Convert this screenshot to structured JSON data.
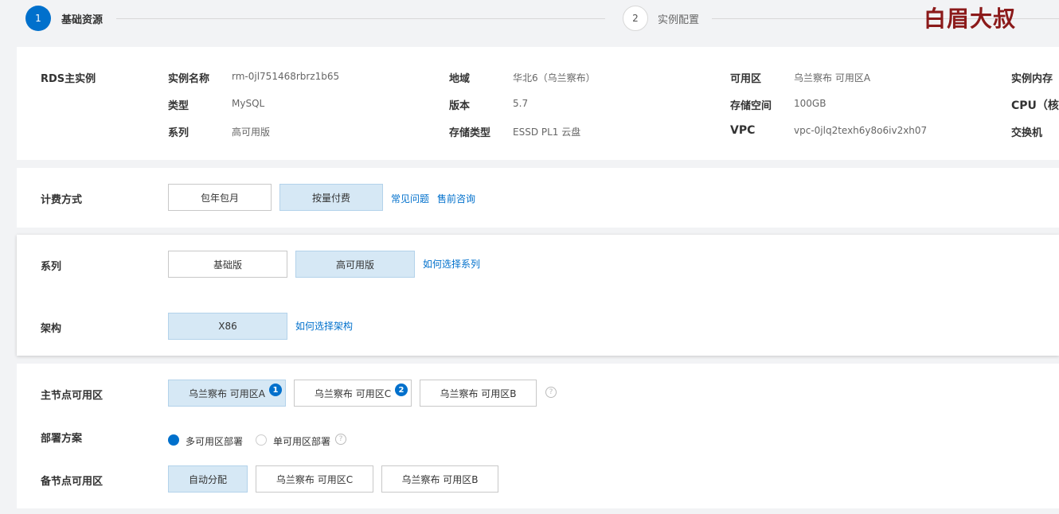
{
  "steps": [
    {
      "number": "1",
      "label": "基础资源"
    },
    {
      "number": "2",
      "label": "实例配置"
    }
  ],
  "watermark": "白眉大叔",
  "rds": {
    "title": "RDS主实例",
    "fields": {
      "instance_name": {
        "label": "实例名称",
        "value": "rm-0jl751468rbrz1b65"
      },
      "region": {
        "label": "地域",
        "value": "华北6（乌兰察布）"
      },
      "zone": {
        "label": "可用区",
        "value": "乌兰察布 可用区A"
      },
      "memory": {
        "label": "实例内存",
        "value": ""
      },
      "type": {
        "label": "类型",
        "value": "MySQL"
      },
      "version": {
        "label": "版本",
        "value": "5.7"
      },
      "storage": {
        "label": "存储空间",
        "value": "100GB"
      },
      "cpu": {
        "label": "CPU（核）",
        "value": ""
      },
      "series": {
        "label": "系列",
        "value": "高可用版"
      },
      "storage_type": {
        "label": "存储类型",
        "value": "ESSD PL1 云盘"
      },
      "vpc": {
        "label": "VPC",
        "value": "vpc-0jlq2texh6y8o6iv2xh07"
      },
      "switch": {
        "label": "交换机",
        "value": ""
      }
    }
  },
  "billing": {
    "title": "计费方式",
    "options": [
      "包年包月",
      "按量付费"
    ],
    "selected": "按量付费",
    "links": [
      "常见问题",
      "售前咨询"
    ]
  },
  "series": {
    "title": "系列",
    "options": [
      "基础版",
      "高可用版"
    ],
    "selected": "高可用版",
    "link": "如何选择系列"
  },
  "arch": {
    "title": "架构",
    "options": [
      "X86"
    ],
    "selected": "X86",
    "link": "如何选择架构"
  },
  "primary_zone": {
    "title": "主节点可用区",
    "options": [
      {
        "label": "乌兰察布 可用区A",
        "badge": "1"
      },
      {
        "label": "乌兰察布 可用区C",
        "badge": "2"
      },
      {
        "label": "乌兰察布 可用区B",
        "badge": ""
      }
    ],
    "selected": "乌兰察布 可用区A",
    "help": "?"
  },
  "deploy": {
    "title": "部署方案",
    "options": [
      "多可用区部署",
      "单可用区部署"
    ],
    "selected": "多可用区部署",
    "help": "?"
  },
  "backup_zone": {
    "title": "备节点可用区",
    "options": [
      "自动分配",
      "乌兰察布 可用区C",
      "乌兰察布 可用区B"
    ],
    "selected": "自动分配"
  },
  "colors": {
    "accent": "#0070cc",
    "selected_bg": "#d6e8f5",
    "watermark": "#8b1a1a"
  }
}
